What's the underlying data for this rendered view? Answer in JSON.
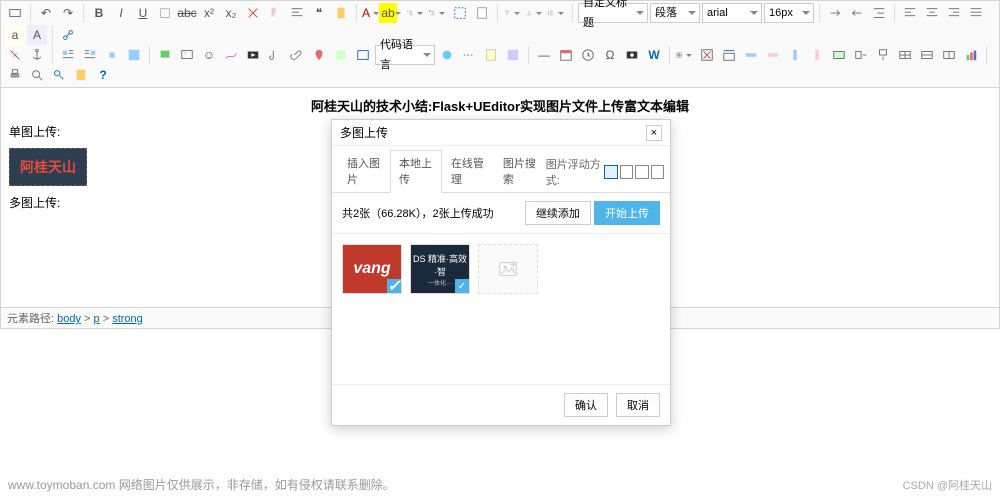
{
  "toolbar": {
    "row1": {
      "combos": {
        "para": "自定义标题",
        "style": "段落",
        "font": "arial",
        "size": "16px"
      }
    },
    "row2": {
      "codelang": "代码语言"
    },
    "icons": {
      "source": "源",
      "undo": "↶",
      "redo": "↷",
      "bold": "B",
      "italic": "I",
      "underline": "U",
      "fontborder": "▢",
      "strike": "S",
      "super": "x²",
      "sub": "x₂",
      "blockquote": "❝",
      "pasteplain": "📋",
      "fontcolor": "A",
      "backcolor": "✎",
      "insertol": "1.",
      "insertul": "•",
      "selectall": "☐",
      "print": "🖨",
      "preview": "👁",
      "link": "🔗",
      "unlink": "⛓",
      "emotion": "☺",
      "spechars": "Ω",
      "search": "🔍",
      "help": "?"
    }
  },
  "editor": {
    "title": "阿桂天山的技术小结:Flask+UEditor实现图片文件上传富文本编辑",
    "single_label": "单图上传:",
    "badge_text": "阿桂天山",
    "multi_label": "多图上传:"
  },
  "path": {
    "prefix": "元素路径:",
    "crumbs": [
      "body",
      "p",
      "strong"
    ]
  },
  "dialog": {
    "title": "多图上传",
    "tabs": [
      "插入图片",
      "本地上传",
      "在线管理",
      "图片搜索"
    ],
    "active_tab": 1,
    "float_label": "图片浮动方式:",
    "status": "共2张（66.28K），2张上传成功",
    "add_more": "继续添加",
    "start_upload": "开始上传",
    "thumbs": {
      "img1_text": "vang",
      "img2_line1": "DS 精准·高效·智",
      "img2_line2": "一体化···"
    },
    "ok": "确认",
    "cancel": "取消"
  },
  "footer": {
    "watermark": "www.toymoban.com 网络图片仅供展示，非存储，如有侵权请联系删除。",
    "credit": "CSDN @阿桂天山"
  }
}
